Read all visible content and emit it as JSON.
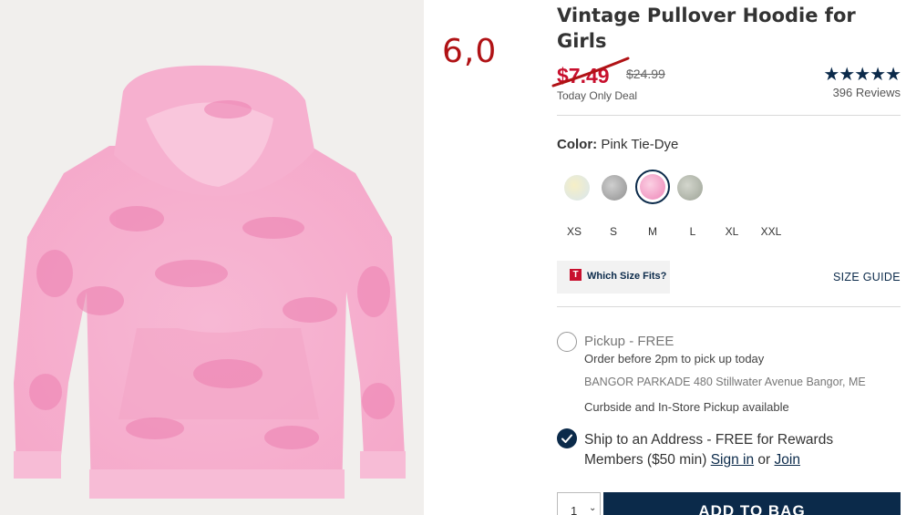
{
  "annotation": {
    "handwritten_number": "6,0",
    "color": "#b01215"
  },
  "product": {
    "title": "Vintage Pullover Hoodie for Girls",
    "sale_price": "$7.49",
    "original_price": "$24.99",
    "deal_label": "Today Only Deal",
    "rating_stars": "★★★★★",
    "review_count": "396 Reviews",
    "rating_value": 5
  },
  "color": {
    "label": "Color:",
    "selected": "Pink Tie-Dye",
    "swatches": [
      {
        "name": "yellow-blue-tie-dye",
        "color": "#f1e6b8"
      },
      {
        "name": "gray-camo",
        "color": "#a9a9a9"
      },
      {
        "name": "pink-tie-dye",
        "color": "#f29ac4",
        "selected": true
      },
      {
        "name": "sage-tie-dye",
        "color": "#b9bdb2"
      }
    ]
  },
  "sizes": [
    "XS",
    "S",
    "M",
    "L",
    "XL",
    "XXL"
  ],
  "size_help": {
    "logo_letter": "T",
    "which_size_fits": "Which Size Fits?",
    "size_guide": "SIZE GUIDE"
  },
  "pickup": {
    "title": "Pickup - FREE",
    "subtitle": "Order before 2pm to pick up today",
    "store_name": "BANGOR PARKADE",
    "store_address": "480 Stillwater Avenue",
    "store_city": "Bangor, ME",
    "curbside": "Curbside and In-Store Pickup available"
  },
  "shipping": {
    "text_before": "Ship to an Address - FREE for Rewards Members ($50 min)",
    "sign_in": "Sign in",
    "or": "or",
    "join": "Join"
  },
  "cart": {
    "quantity": "1",
    "add_to_bag": "ADD TO BAG"
  },
  "colors": {
    "navy": "#0b2a4a",
    "sale_red": "#c8102e"
  }
}
